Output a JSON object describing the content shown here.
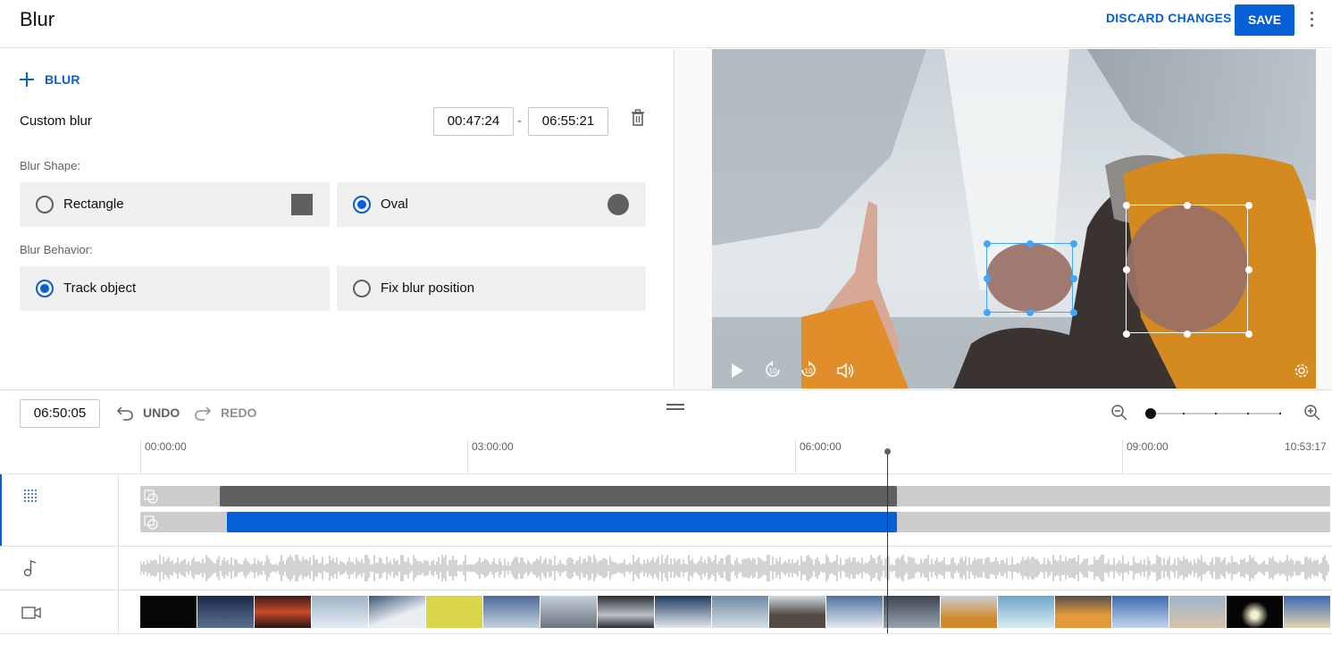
{
  "header": {
    "title": "Blur",
    "discard_label": "DISCARD CHANGES",
    "save_label": "SAVE",
    "menu_icon": "more-vert-icon"
  },
  "editor": {
    "add_blur_label": "BLUR",
    "blur_item": {
      "name": "Custom blur",
      "start_time": "00:47:24",
      "end_time": "06:55:21",
      "separator": "-"
    },
    "shape_section_label": "Blur Shape:",
    "shape_options": [
      {
        "label": "Rectangle",
        "selected": false
      },
      {
        "label": "Oval",
        "selected": true
      }
    ],
    "behavior_section_label": "Blur Behavior:",
    "behavior_options": [
      {
        "label": "Track object",
        "selected": true
      },
      {
        "label": "Fix blur position",
        "selected": false
      }
    ]
  },
  "player": {
    "controls": [
      "play-icon",
      "rewind-10-icon",
      "forward-10-icon",
      "volume-icon",
      "settings-icon"
    ]
  },
  "timeline": {
    "current_time": "06:50:05",
    "undo_label": "UNDO",
    "redo_label": "REDO",
    "zoom_level_fraction": 0,
    "ruler_labels": [
      "00:00:00",
      "03:00:00",
      "06:00:00",
      "09:00:00",
      "10:53:17"
    ],
    "total_duration": "10:53:17",
    "playhead_time": "06:50:05",
    "tracks": [
      "blur-track-icon",
      "audio-track-icon",
      "video-track-icon"
    ]
  },
  "colors": {
    "accent": "#065fd4",
    "blur_bar_dark": "#606060",
    "track_bg": "#cccccc",
    "option_bg": "#f0f0f0",
    "selection_handle": "#3ea6ff"
  }
}
